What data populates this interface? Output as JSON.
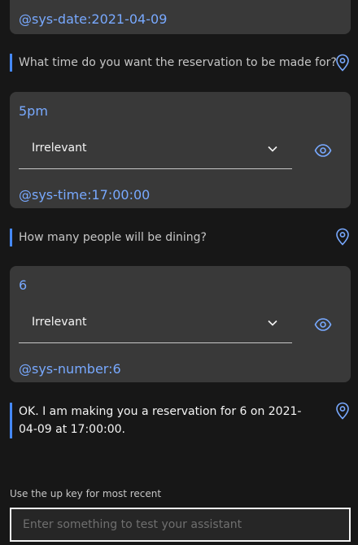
{
  "turns": [
    {
      "entity": "@sys-date:2021-04-09"
    },
    {
      "question": "What time do you want the reservation to be made for?",
      "user_input": "5pm",
      "intent_dropdown": "Irrelevant",
      "entity": "@sys-time:17:00:00"
    },
    {
      "question": "How many people will be dining?",
      "user_input": "6",
      "intent_dropdown": "Irrelevant",
      "entity": "@sys-number:6"
    },
    {
      "question": "OK. I am making you a reservation for 6 on 2021-04-09 at 17:00:00."
    }
  ],
  "input": {
    "hint": "Use the up key for most recent",
    "placeholder": "Enter something to test your assistant"
  },
  "icons": {
    "location": "location-pin-icon",
    "eye": "eye-icon",
    "chevron": "chevron-down-icon"
  },
  "colors": {
    "accent": "#4589ff",
    "link": "#78a9ff",
    "background": "#171717",
    "card": "#393939"
  }
}
